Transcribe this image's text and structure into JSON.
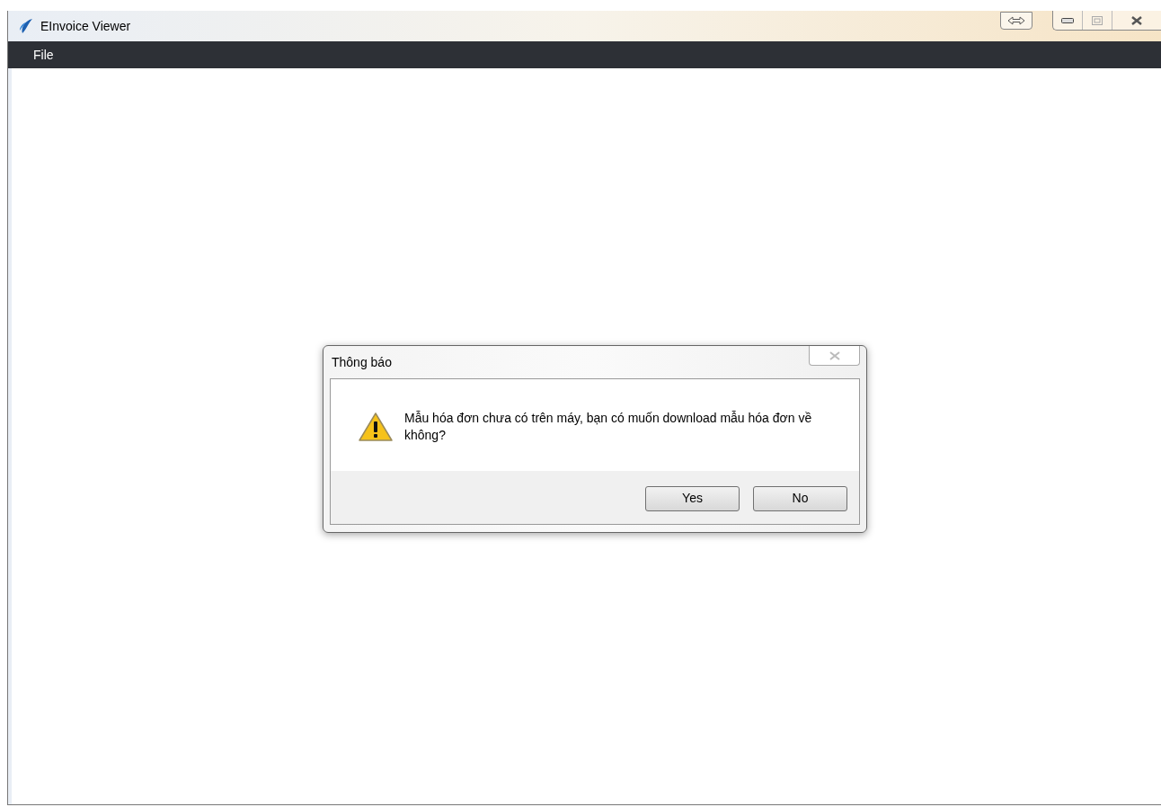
{
  "window": {
    "title": "EInvoice Viewer"
  },
  "menu": [
    "File"
  ],
  "dialog": {
    "title": "Thông báo",
    "message": "Mẫu hóa đơn chưa có trên máy, bạn có muốn download mẫu hóa đơn về không?",
    "buttons": [
      "Yes",
      "No"
    ]
  }
}
